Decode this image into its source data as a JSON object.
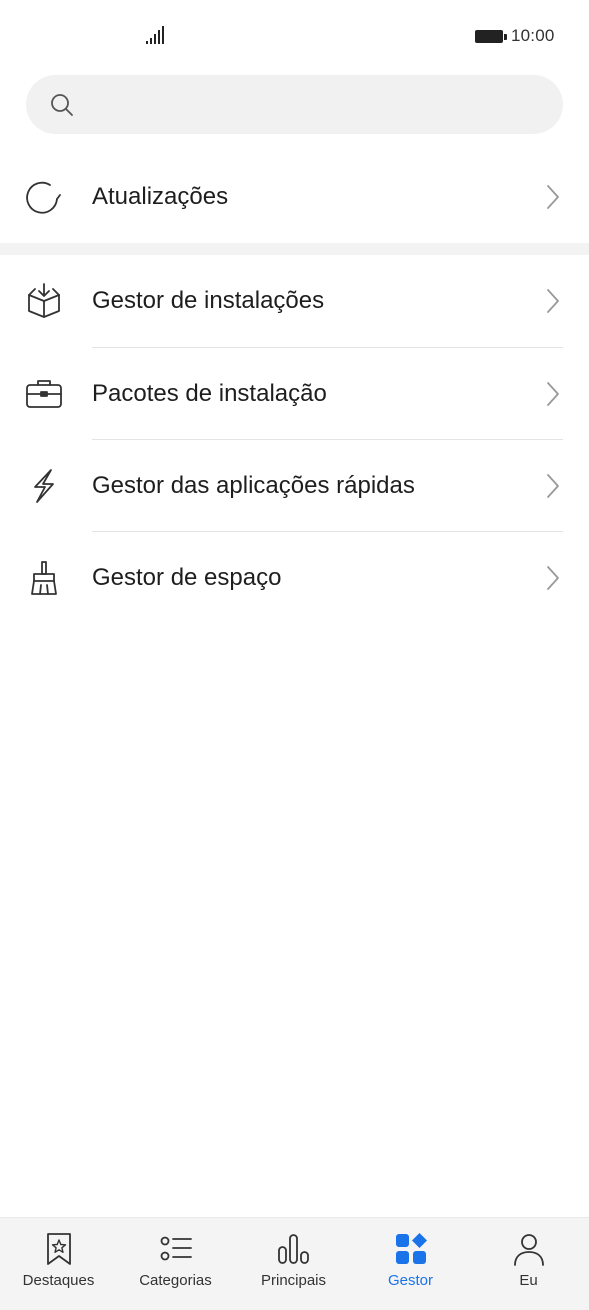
{
  "status_bar": {
    "time": "10:00"
  },
  "search": {
    "placeholder": ""
  },
  "rows": [
    {
      "label": "Atualizações",
      "icon": "refresh-icon"
    },
    {
      "label": "Gestor de instalações",
      "icon": "box-download-icon"
    },
    {
      "label": "Pacotes de instalação",
      "icon": "briefcase-icon"
    },
    {
      "label": "Gestor das aplicações rápidas",
      "icon": "lightning-icon"
    },
    {
      "label": "Gestor de espaço",
      "icon": "broom-icon"
    }
  ],
  "bottom_nav": {
    "active": "Gestor",
    "active_color": "#1a73e8",
    "items": [
      {
        "label": "Destaques",
        "icon": "bookmark-star-icon"
      },
      {
        "label": "Categorias",
        "icon": "list-icon"
      },
      {
        "label": "Principais",
        "icon": "bar-chart-icon"
      },
      {
        "label": "Gestor",
        "icon": "grid-diamond-icon"
      },
      {
        "label": "Eu",
        "icon": "person-icon"
      }
    ]
  }
}
